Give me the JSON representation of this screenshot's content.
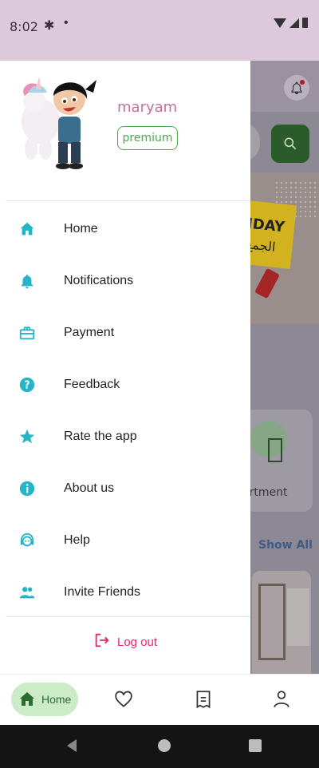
{
  "status_bar": {
    "time": "8:02",
    "dot": "•"
  },
  "drawer": {
    "user": {
      "name": "maryam",
      "badge": "premium"
    },
    "menu": [
      {
        "label": "Home",
        "icon": "home-icon",
        "color": "#26b4c7"
      },
      {
        "label": "Notifications",
        "icon": "bell-icon",
        "color": "#26b4c7"
      },
      {
        "label": "Payment",
        "icon": "payment-icon",
        "color": "#26b4c7"
      },
      {
        "label": "Feedback",
        "icon": "help-circle-icon",
        "color": "#26b4c7"
      },
      {
        "label": "Rate the app",
        "icon": "star-icon",
        "color": "#26b4c7"
      },
      {
        "label": "About us",
        "icon": "info-icon",
        "color": "#26b4c7"
      },
      {
        "label": "Help",
        "icon": "support-agent-icon",
        "color": "#26b4c7"
      },
      {
        "label": "Invite Friends",
        "icon": "group-icon",
        "color": "#26b4c7"
      }
    ],
    "logout": {
      "label": "Log out",
      "color": "#e3286c"
    }
  },
  "background": {
    "banner_text": "IDAY",
    "banner_arabic": "الجمع",
    "card_label": "artment",
    "show_all": "Show All"
  },
  "bottom_nav": {
    "home_label": "Home",
    "items": [
      "home-icon",
      "heart-icon",
      "receipt-icon",
      "person-icon"
    ],
    "active_color": "#ccebc7"
  },
  "colors": {
    "accent": "#26b4c7",
    "premium": "#4ea84e",
    "username": "#c56fa1",
    "status_bar": "#dcc9dc"
  }
}
